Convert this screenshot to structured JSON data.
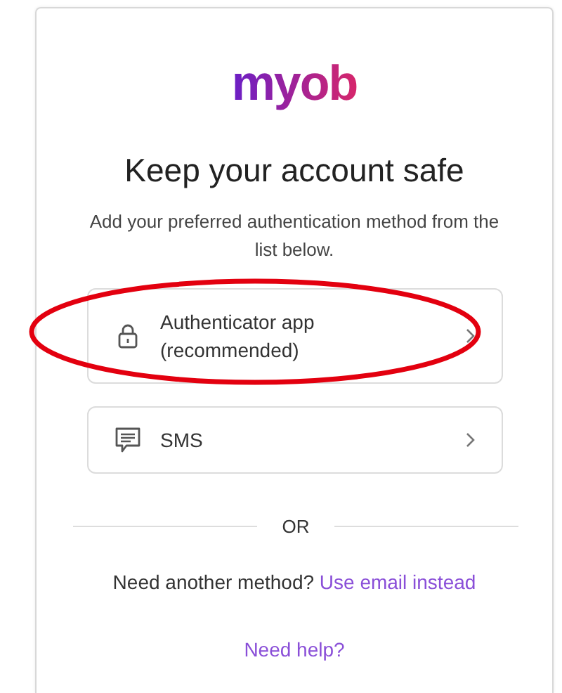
{
  "logo": {
    "text": "myob"
  },
  "heading": "Keep your account safe",
  "subtitle": "Add your preferred authentication method from the list below.",
  "methods": [
    {
      "kind": "lock",
      "label": "Authenticator app (recommended)",
      "highlighted": true
    },
    {
      "kind": "message",
      "label": "SMS",
      "highlighted": false
    }
  ],
  "divider_text": "OR",
  "alternative": {
    "prompt": "Need another method?",
    "link": "Use email instead"
  },
  "help_link": "Need help?"
}
